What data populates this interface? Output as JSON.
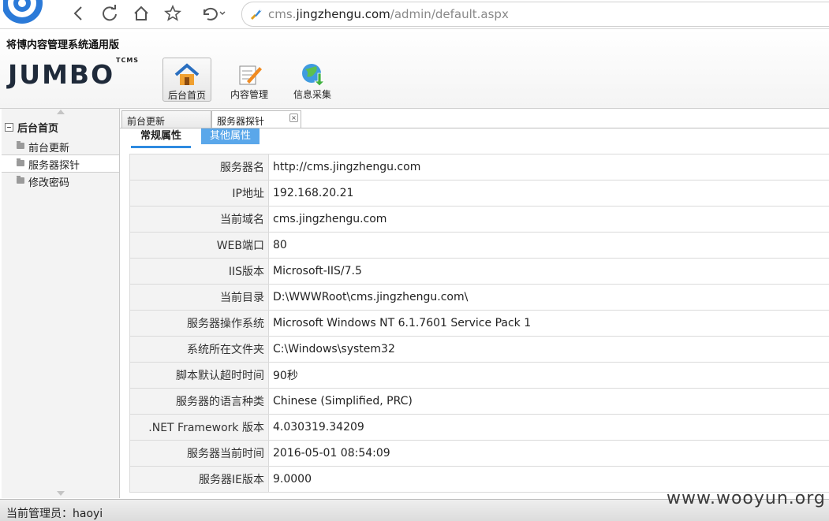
{
  "browser": {
    "url_prefix": "cms.",
    "url_host": "jingzhengu.com",
    "url_path": "/admin/default.aspx"
  },
  "app": {
    "title": "将博内容管理系统通用版",
    "logo_text": "JUMBO",
    "logo_badge": "TCMS"
  },
  "topnav": [
    {
      "label": "后台首页",
      "icon": "home-icon"
    },
    {
      "label": "内容管理",
      "icon": "edit-icon"
    },
    {
      "label": "信息采集",
      "icon": "globe-download-icon"
    }
  ],
  "sidebar": {
    "root": "后台首页",
    "items": [
      {
        "label": "前台更新"
      },
      {
        "label": "服务器探针"
      },
      {
        "label": "修改密码"
      }
    ]
  },
  "tabs": [
    {
      "label": "前台更新"
    },
    {
      "label": "服务器探针"
    }
  ],
  "subtabs": {
    "general": "常规属性",
    "other": "其他属性"
  },
  "properties": [
    {
      "key": "服务器名",
      "value": "http://cms.jingzhengu.com"
    },
    {
      "key": "IP地址",
      "value": "192.168.20.21"
    },
    {
      "key": "当前域名",
      "value": "cms.jingzhengu.com"
    },
    {
      "key": "WEB端口",
      "value": "80"
    },
    {
      "key": "IIS版本",
      "value": "Microsoft-IIS/7.5"
    },
    {
      "key": "当前目录",
      "value": "D:\\WWWRoot\\cms.jingzhengu.com\\"
    },
    {
      "key": "服务器操作系统",
      "value": "Microsoft Windows NT 6.1.7601 Service Pack 1"
    },
    {
      "key": "系统所在文件夹",
      "value": "C:\\Windows\\system32"
    },
    {
      "key": "脚本默认超时时间",
      "value": "90秒"
    },
    {
      "key": "服务器的语言种类",
      "value": "Chinese (Simplified, PRC)"
    },
    {
      "key": ".NET Framework 版本",
      "value": "4.030319.34209"
    },
    {
      "key": "服务器当前时间",
      "value": "2016-05-01 08:54:09"
    },
    {
      "key": "服务器IE版本",
      "value": "9.0000"
    }
  ],
  "status": {
    "text": "当前管理员：haoyi"
  },
  "watermark": "www.wooyun.org",
  "colors": {
    "accent": "#2e8be0",
    "subtab_other_bg": "#5aa7ea"
  }
}
